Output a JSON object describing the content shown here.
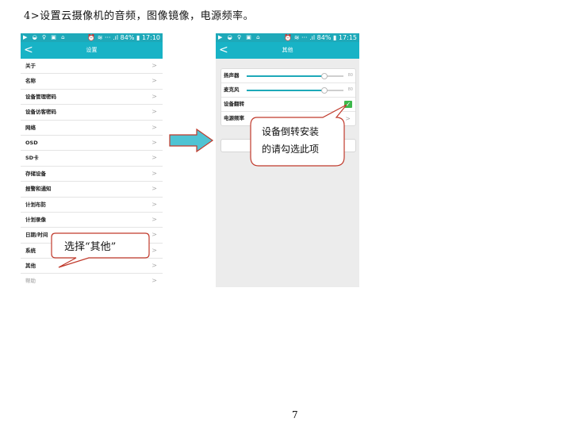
{
  "heading": "4>设置云摄像机的音频，图像镜像，电源频率。",
  "page_number": "7",
  "phone1": {
    "status_left": "▶ ◒ ♀ ▣ ⌂",
    "status_right": "⏰ ≋ ··· .ıl 84% ▮ 17:10",
    "back_icon": "<",
    "title": "设置",
    "items": [
      "关于",
      "名称",
      "设备管理密码",
      "设备访客密码",
      "网络",
      "OSD",
      "SD卡",
      "存储设备",
      "报警和通知",
      "计划布防",
      "计划录像",
      "日期/时间",
      "系统",
      "其他",
      "帮助"
    ],
    "chevron": ">"
  },
  "phone2": {
    "status_left": "▶ ◒ ♀ ▣ ⌂",
    "status_right": "⏰ ≋ ··· .ıl 84% ▮ 17:15",
    "back_icon": "<",
    "title": "其他",
    "rows": {
      "speaker": {
        "label": "扬声器",
        "value": "80",
        "level": 0.8
      },
      "mic": {
        "label": "麦克风",
        "value": "80",
        "level": 0.8
      },
      "flip": {
        "label": "设备翻转",
        "checked": true,
        "check_glyph": "✓"
      },
      "power": {
        "label": "电源频率",
        "chevron": ">"
      }
    }
  },
  "callouts": {
    "select_other": "选择“其他”",
    "flip_line1": "设备倒转安装",
    "flip_line2": "的请勾选此项"
  },
  "colors": {
    "teal": "#1ea9b9",
    "check_green": "#3db84b",
    "arrow_fill": "#4fc3d3"
  }
}
